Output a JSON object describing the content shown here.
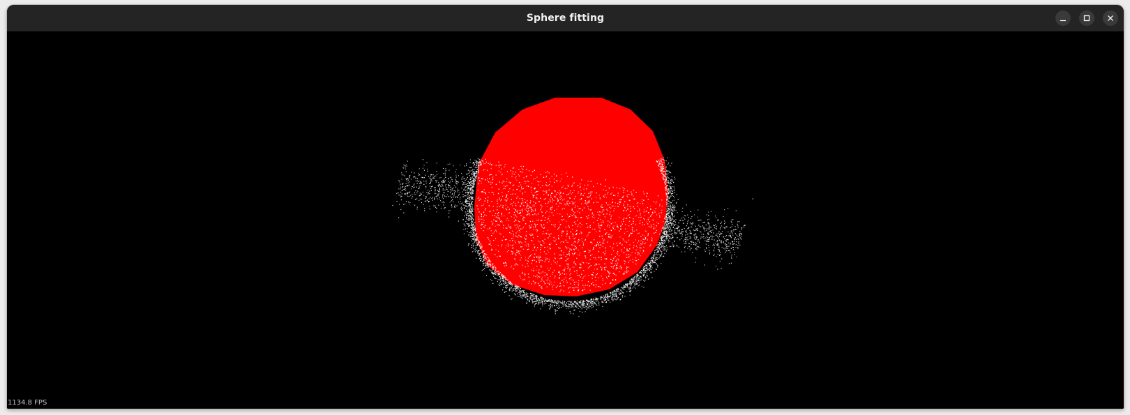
{
  "window": {
    "title": "Sphere fitting",
    "controls": {
      "minimize_icon": "minimize-icon",
      "maximize_icon": "maximize-icon",
      "close_icon": "close-icon"
    }
  },
  "viewport": {
    "background_color": "#000000",
    "sphere_color": "#ff0000",
    "point_color": "#ffffff",
    "fps_label": "1134.8 FPS"
  }
}
